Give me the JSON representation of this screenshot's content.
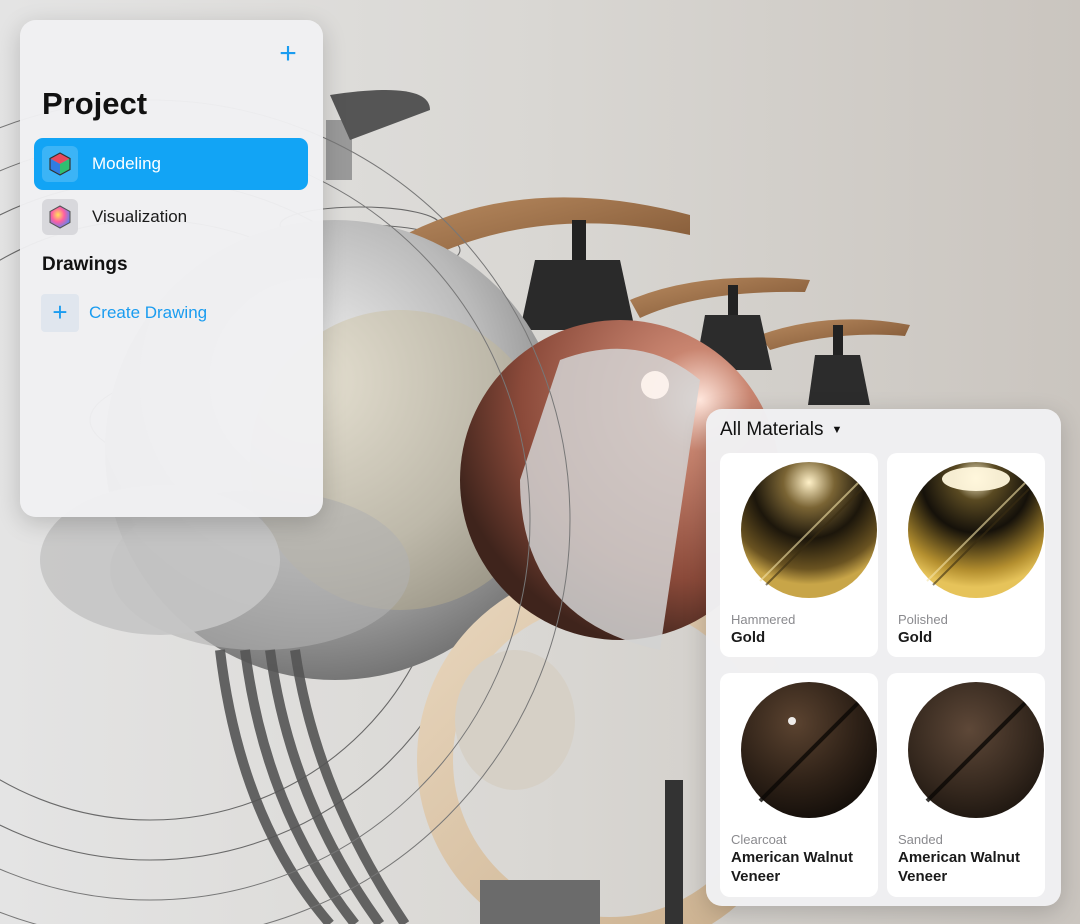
{
  "project_panel": {
    "title": "Project",
    "add_icon": "plus-icon",
    "items": [
      {
        "label": "Modeling",
        "icon": "cube-icon",
        "active": true
      },
      {
        "label": "Visualization",
        "icon": "color-hexagon-icon",
        "active": false
      }
    ],
    "drawings_heading": "Drawings",
    "create_drawing_label": "Create Drawing"
  },
  "materials_panel": {
    "filter_label": "All Materials",
    "materials": [
      {
        "finish": "Hammered",
        "name": "Gold"
      },
      {
        "finish": "Polished",
        "name": "Gold"
      },
      {
        "finish": "Clearcoat",
        "name": "American Walnut\nVeneer"
      },
      {
        "finish": "Sanded",
        "name": "American Walnut\nVeneer"
      }
    ]
  },
  "colors": {
    "accent": "#12a4f5",
    "link": "#1a9cf0"
  }
}
